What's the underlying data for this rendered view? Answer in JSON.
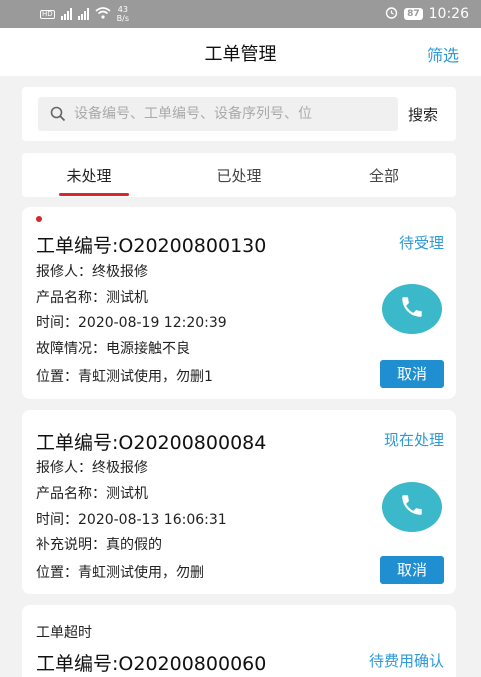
{
  "status_bar": {
    "network_speed": "43",
    "network_unit": "B/s",
    "battery": "87",
    "time": "10:26"
  },
  "header": {
    "title": "工单管理",
    "filter_label": "筛选"
  },
  "search": {
    "placeholder": "设备编号、工单编号、设备序列号、位",
    "button_label": "搜索"
  },
  "tabs": [
    {
      "label": "未处理",
      "active": true
    },
    {
      "label": "已处理",
      "active": false
    },
    {
      "label": "全部",
      "active": false
    }
  ],
  "colors": {
    "accent": "#2e9ad6",
    "tab_underline": "#d9262c",
    "phone_button": "#3bb8c9",
    "cancel_button": "#1f8fd1"
  },
  "orders": [
    {
      "order_no": "工单编号:O20200800130",
      "status": "待受理",
      "reporter": "报修人：终极报修",
      "product": "产品名称：测试机",
      "time": "时间：2020-08-19 12:20:39",
      "detail": "故障情况：电源接触不良",
      "location": "位置：青虹测试使用，勿删1",
      "cancel_label": "取消",
      "phone_icon": "phone-icon"
    },
    {
      "order_no": "工单编号:O20200800084",
      "status": "现在处理",
      "reporter": "报修人：终极报修",
      "product": "产品名称：测试机",
      "time": "时间：2020-08-13 16:06:31",
      "detail": "补充说明：真的假的",
      "location": "位置：青虹测试使用，勿删",
      "cancel_label": "取消",
      "phone_icon": "phone-icon"
    },
    {
      "overtime": "工单超时",
      "order_no": "工单编号:O20200800060",
      "status": "待费用确认"
    }
  ]
}
